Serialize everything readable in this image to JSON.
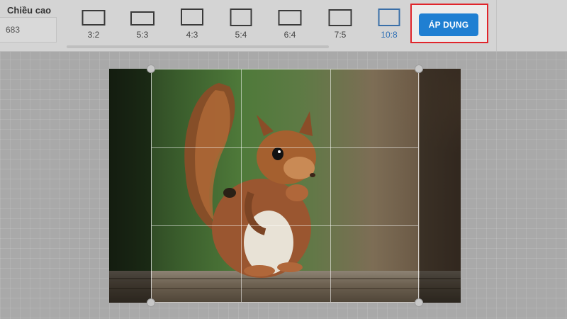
{
  "height_field": {
    "label": "Chiều cao",
    "value": "683"
  },
  "aspect_ratios": [
    {
      "label": "3:2",
      "selected": false
    },
    {
      "label": "5:3",
      "selected": false
    },
    {
      "label": "4:3",
      "selected": false
    },
    {
      "label": "5:4",
      "selected": false
    },
    {
      "label": "6:4",
      "selected": false
    },
    {
      "label": "7:5",
      "selected": false
    },
    {
      "label": "10:8",
      "selected": true
    }
  ],
  "apply_button": {
    "label": "ÁP DỤNG",
    "color": "#1f7fd2",
    "highlight_color": "#e0252b"
  },
  "canvas": {
    "image_subject": "squirrel-photo",
    "crop_grid": "3x3"
  },
  "colors": {
    "accent": "#2e6fb5",
    "toolbar_bg": "#d4d4d4",
    "workspace_bg": "#a9a9a9"
  }
}
